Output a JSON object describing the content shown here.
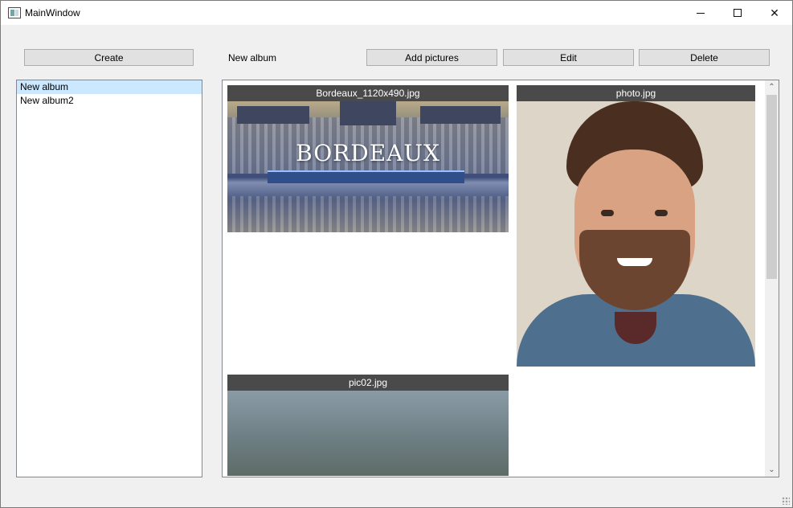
{
  "window": {
    "title": "MainWindow",
    "minimize_icon": "minimize-icon",
    "maximize_icon": "maximize-icon",
    "close_icon": "close-icon",
    "close_glyph": "✕"
  },
  "toolbar": {
    "create_label": "Create",
    "current_album": "New album",
    "add_pictures_label": "Add pictures",
    "edit_label": "Edit",
    "delete_label": "Delete"
  },
  "albums": {
    "items": [
      {
        "label": "New album",
        "selected": true
      },
      {
        "label": "New album2",
        "selected": false
      }
    ]
  },
  "gallery": {
    "pictures": [
      {
        "title": "Bordeaux_1120x490.jpg",
        "image_text": "BORDEAUX"
      },
      {
        "title": "photo.jpg"
      },
      {
        "title": "pic02.jpg"
      }
    ],
    "scroll": {
      "up_glyph": "⌃",
      "down_glyph": "⌄"
    }
  },
  "colors": {
    "selection": "#cce8ff",
    "caption_bar": "#4a4a4a",
    "button_face": "#e1e1e1"
  }
}
